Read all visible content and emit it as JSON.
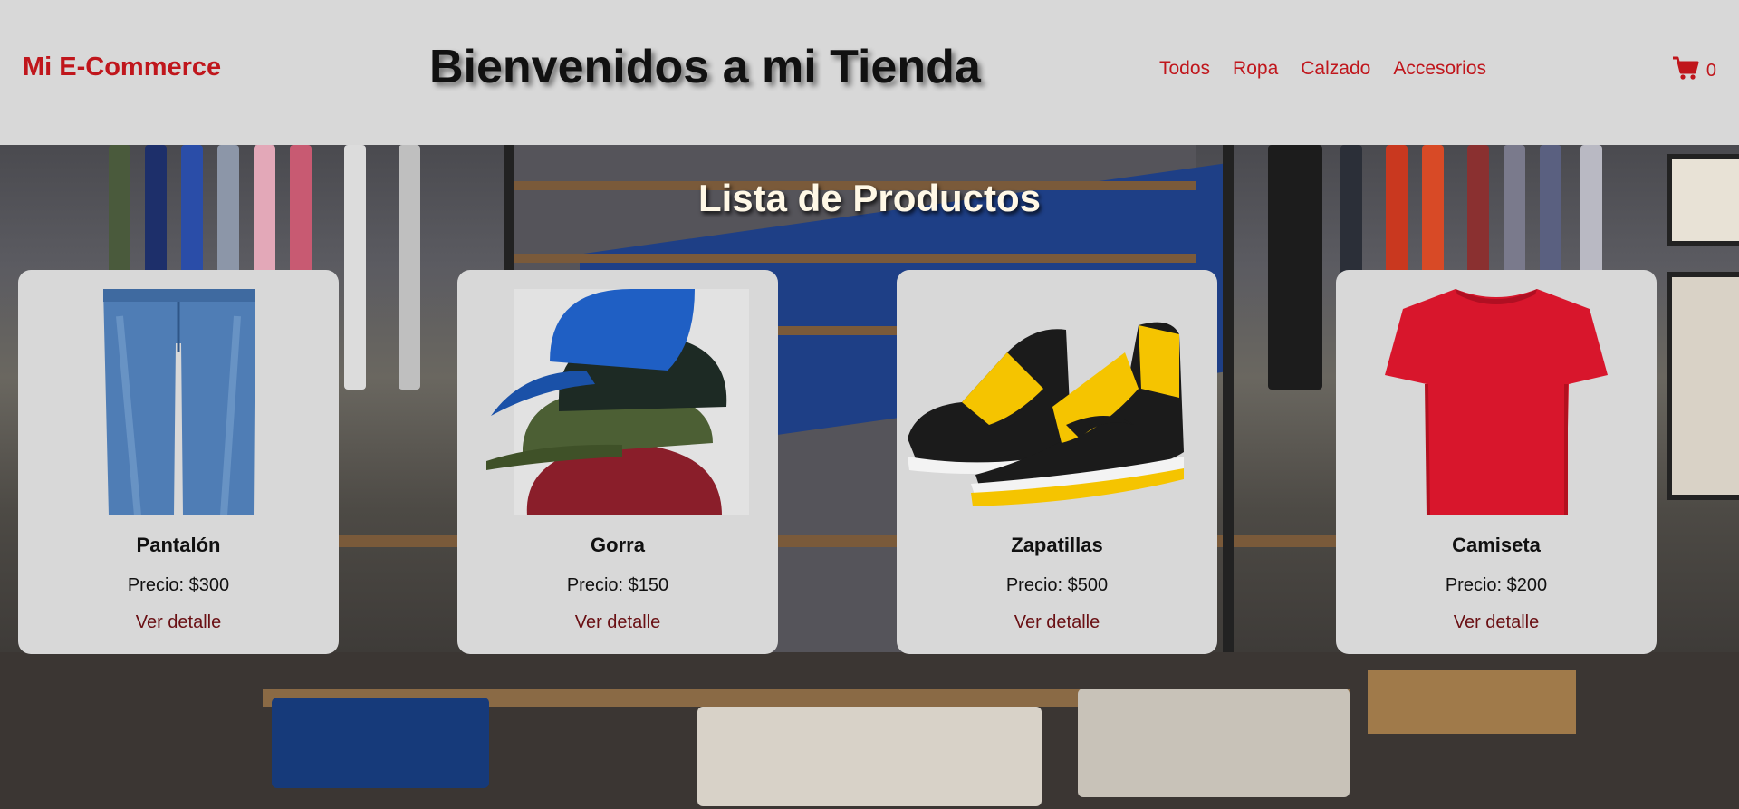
{
  "header": {
    "logo": "Mi E-Commerce",
    "welcome": "Bienvenidos a mi Tienda",
    "nav": [
      "Todos",
      "Ropa",
      "Calzado",
      "Accesorios"
    ],
    "cart_icon": "shopping-cart-icon",
    "cart_count": "0"
  },
  "main": {
    "title": "Lista de Productos",
    "products": [
      {
        "name": "Pantalón",
        "price": "Precio: $300",
        "link": "Ver detalle",
        "image": "jeans-image"
      },
      {
        "name": "Gorra",
        "price": "Precio: $150",
        "link": "Ver detalle",
        "image": "caps-image"
      },
      {
        "name": "Zapatillas",
        "price": "Precio: $500",
        "link": "Ver detalle",
        "image": "sneakers-image"
      },
      {
        "name": "Camiseta",
        "price": "Precio: $200",
        "link": "Ver detalle",
        "image": "tshirt-image"
      }
    ]
  },
  "colors": {
    "accent": "#c0161c",
    "link_dark": "#6a1014",
    "header_bg": "#d8d8d8"
  }
}
